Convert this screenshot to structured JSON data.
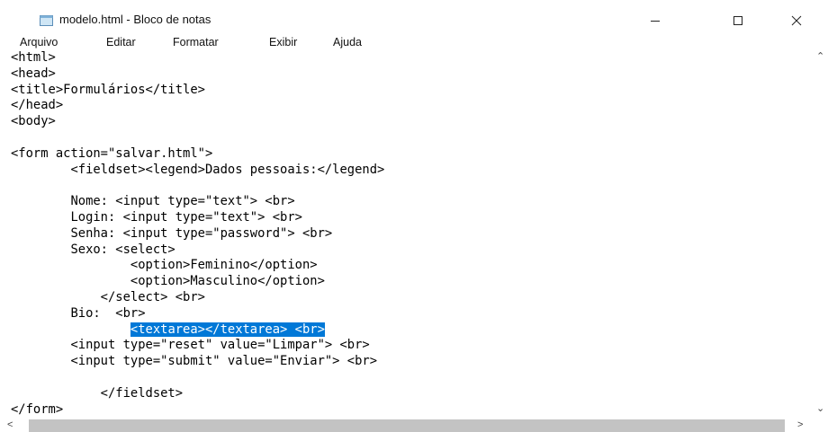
{
  "window": {
    "title": "modelo.html - Bloco de notas",
    "icon": "notepad-icon"
  },
  "menu": {
    "items": [
      "Arquivo",
      "Editar",
      "Formatar",
      "Exibir",
      "Ajuda"
    ]
  },
  "editor": {
    "lines_before": "<html>\n<head>\n<title>Formulários</title>\n</head>\n<body>\n\n<form action=\"salvar.html\">\n        <fieldset><legend>Dados pessoais:</legend>\n\n        Nome: <input type=\"text\"> <br>\n        Login: <input type=\"text\"> <br>\n        Senha: <input type=\"password\"> <br>\n        Sexo: <select>\n                <option>Feminino</option>\n                <option>Masculino</option>\n            </select> <br>\n        Bio:  <br>\n                ",
    "selected_text": "<textarea></textarea> <br>",
    "lines_after": "\n        <input type=\"reset\" value=\"Limpar\"> <br>\n        <input type=\"submit\" value=\"Enviar\"> <br>\n\n            </fieldset>\n</form>\n\n</body>"
  },
  "colors": {
    "selection": "#0078d7"
  }
}
